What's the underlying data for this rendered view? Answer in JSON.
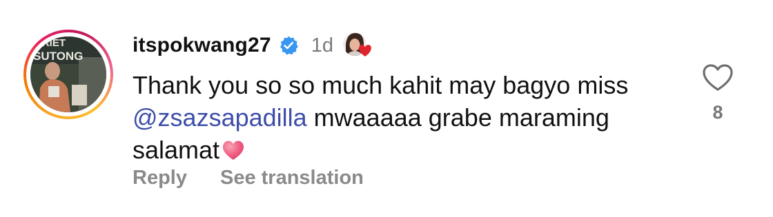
{
  "comment": {
    "username": "itspokwang27",
    "verified": true,
    "timestamp": "1d",
    "text_before_mention": "Thank you so so much kahit may bagyo miss ",
    "mention": "@zsazsapadilla",
    "text_after_mention": " mwaaaaa grabe maraming salamat",
    "emoji": "pink-heart",
    "like_count": "8"
  },
  "avatar": {
    "sign_line_1": "ARIET",
    "sign_line_2": "SUTONG"
  },
  "actions": {
    "reply_label": "Reply",
    "translate_label": "See translation"
  },
  "colors": {
    "mention": "#3d4da8",
    "verified_badge": "#3897f0",
    "heart_emoji": "#ef5b80",
    "liked_by_heart": "#e0242c",
    "secondary_text": "#8a8a8a"
  },
  "icons": {
    "verified": "verified-badge-icon",
    "liked_by_author": "author-liked-heart-icon",
    "like": "heart-outline-icon"
  }
}
